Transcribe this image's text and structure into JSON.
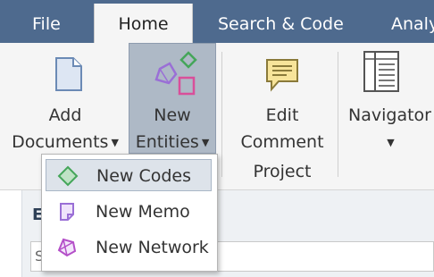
{
  "tabs": [
    {
      "label": "File"
    },
    {
      "label": "Home"
    },
    {
      "label": "Search & Code"
    },
    {
      "label": "Analy"
    }
  ],
  "ribbon": {
    "add_documents": {
      "line1": "Add",
      "line2": "Documents",
      "icon": "document-icon"
    },
    "new_entities": {
      "line1": "New",
      "line2": "Entities",
      "icon": "entities-icon"
    },
    "edit_comment": {
      "line1": "Edit",
      "line2": "Comment",
      "line3": "Project",
      "icon": "comment-icon"
    },
    "navigator": {
      "line1": "Navigator",
      "icon": "navigator-icon"
    }
  },
  "dropdown": {
    "items": [
      {
        "label": "New Codes",
        "icon": "code-icon"
      },
      {
        "label": "New Memo",
        "icon": "memo-icon"
      },
      {
        "label": "New Network",
        "icon": "network-icon"
      }
    ]
  },
  "background_panel": {
    "title_fragment": "E",
    "input_fragment": "S"
  },
  "colors": {
    "tabbar": "#4e6a8e",
    "ribbon": "#f5f5f5",
    "selected_button": "#aeb9c6",
    "menu_highlight": "#dde3ea"
  }
}
